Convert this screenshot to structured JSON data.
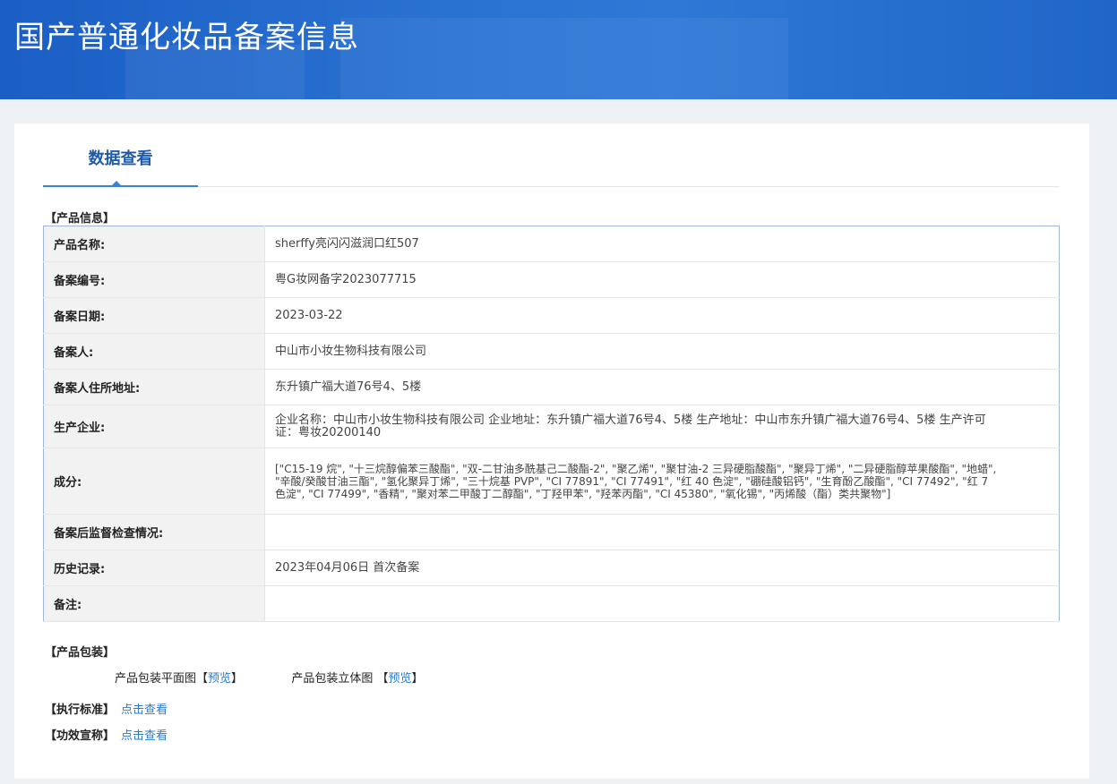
{
  "header": {
    "title": "国产普通化妆品备案信息"
  },
  "tabs": [
    {
      "label": "数据查看"
    }
  ],
  "product_section": {
    "title": "【产品信息】",
    "rows": [
      {
        "label": "产品名称:",
        "value": "sherffy亮闪闪滋润口红507"
      },
      {
        "label": "备案编号:",
        "value": "粤G妆网备字2023077715"
      },
      {
        "label": "备案日期:",
        "value": "2023-03-22"
      },
      {
        "label": "备案人:",
        "value": "中山市小妆生物科技有限公司"
      },
      {
        "label": "备案人住所地址:",
        "value": "东升镇广福大道76号4、5楼"
      },
      {
        "label": "生产企业:",
        "value": "企业名称：中山市小妆生物科技有限公司 企业地址：东升镇广福大道76号4、5楼 生产地址：中山市东升镇广福大道76号4、5楼 生产许可证：粤妆20200140"
      },
      {
        "label": "成分:",
        "value": "[\"C15-19 烷\", \"十三烷醇偏苯三酸酯\", \"双-二甘油多酰基己二酸酯-2\", \"聚乙烯\", \"聚甘油-2 三异硬脂酸酯\", \"聚异丁烯\", \"二异硬脂醇苹果酸酯\", \"地蜡\", \"辛酸/癸酸甘油三酯\", \"氢化聚异丁烯\", \"三十烷基 PVP\", \"CI 77891\", \"CI 77491\", \"红 40 色淀\", \"硼硅酸铝钙\", \"生育酚乙酸酯\", \"CI 77492\", \"红 7 色淀\", \"CI 77499\", \"香精\", \"聚对苯二甲酸丁二醇酯\", \"丁羟甲苯\", \"羟苯丙酯\", \"CI 45380\", \"氧化锡\", \"丙烯酸（酯）类共聚物\"]"
      },
      {
        "label": "备案后监督检查情况:",
        "value": ""
      },
      {
        "label": "历史记录:",
        "value": "2023年04月06日 首次备案"
      },
      {
        "label": "备注:",
        "value": ""
      }
    ]
  },
  "packaging": {
    "title": "【产品包装】",
    "flat_label": "产品包装平面图",
    "flat_link": "预览",
    "solid_label": "产品包装立体图",
    "solid_link": "预览",
    "bracket_open": "【",
    "bracket_close": "】"
  },
  "standard": {
    "label": "【执行标准】",
    "link": "点击查看"
  },
  "efficacy": {
    "label": "【功效宣称】",
    "link": "点击查看"
  }
}
